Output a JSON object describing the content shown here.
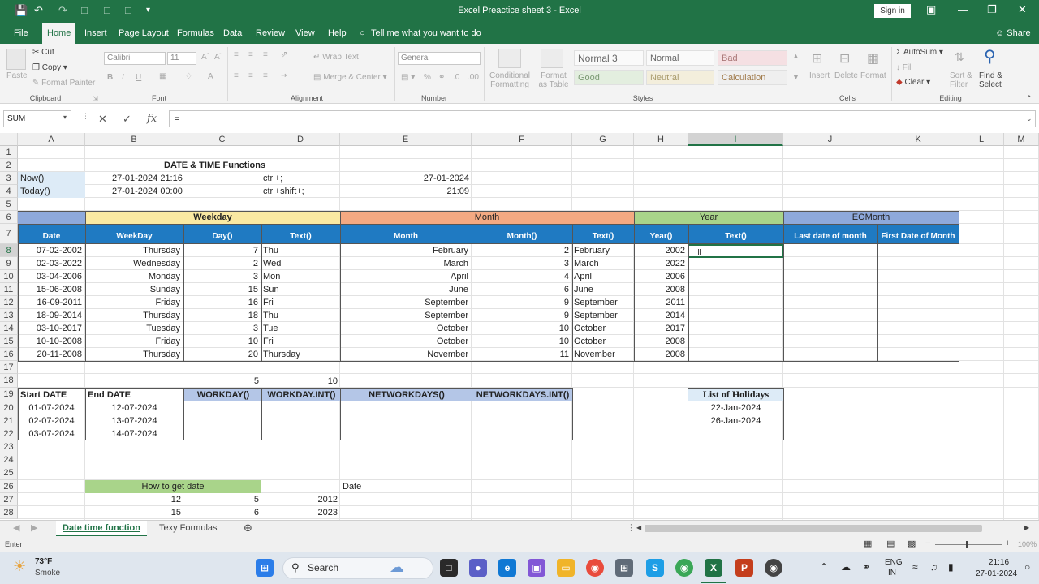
{
  "window": {
    "title": "Excel Preactice sheet 3  -  Excel",
    "sign_in": "Sign in",
    "share": "Share"
  },
  "menu": [
    "File",
    "Home",
    "Insert",
    "Page Layout",
    "Formulas",
    "Data",
    "Review",
    "View",
    "Help"
  ],
  "menu_active": "Home",
  "tell_me": "Tell me what you want to do",
  "ribbon": {
    "clipboard": {
      "paste": "Paste",
      "cut": "Cut",
      "copy": "Copy",
      "format_painter": "Format Painter",
      "label": "Clipboard"
    },
    "font": {
      "name": "Calibri",
      "size": "11",
      "label": "Font"
    },
    "alignment": {
      "wrap": "Wrap Text",
      "merge": "Merge & Center",
      "label": "Alignment"
    },
    "number": {
      "format": "General",
      "label": "Number"
    },
    "styles": {
      "conditional": "Conditional Formatting",
      "format_table": "Format as Table",
      "items": [
        "Normal 3",
        "Normal",
        "Bad",
        "Good",
        "Neutral",
        "Calculation"
      ],
      "label": "Styles"
    },
    "cells": {
      "insert": "Insert",
      "delete": "Delete",
      "format": "Format",
      "label": "Cells"
    },
    "editing": {
      "autosum": "AutoSum",
      "fill": "Fill",
      "clear": "Clear",
      "sort": "Sort & Filter",
      "find": "Find & Select",
      "label": "Editing"
    }
  },
  "formula_bar": {
    "name_box": "SUM",
    "content": "="
  },
  "columns": [
    "A",
    "B",
    "C",
    "D",
    "E",
    "F",
    "G",
    "H",
    "I",
    "J",
    "K",
    "L",
    "M"
  ],
  "selected_column": "I",
  "rows": [
    "1",
    "2",
    "3",
    "4",
    "5",
    "6",
    "7",
    "8",
    "9",
    "10",
    "11",
    "12",
    "13",
    "14",
    "15",
    "16",
    "17",
    "18",
    "19",
    "20",
    "21",
    "22",
    "23",
    "24",
    "25",
    "26",
    "27",
    "28"
  ],
  "selected_row": "8",
  "sheet": {
    "heading": "DATE & TIME Functions",
    "now_label": "Now()",
    "now_value": "27-01-2024 21:16",
    "now_shortcut": "ctrl+;",
    "now_result": "27-01-2024",
    "today_label": "Today()",
    "today_value": "27-01-2024 00:00",
    "today_shortcut": "ctrl+shift+;",
    "today_result": "21:09",
    "groups": {
      "weekday": "Weekday",
      "month": "Month",
      "year": "Year",
      "eomonth": "EOMonth"
    },
    "headers": [
      "Date",
      "WeekDay",
      "Day()",
      "Text()",
      "Month",
      "Month()",
      "Text()",
      "Year()",
      "Text()",
      "Last date of month",
      "First Date of Month"
    ],
    "table_rows": [
      [
        "07-02-2002",
        "Thursday",
        "7",
        "Thu",
        "February",
        "2",
        "February",
        "2002"
      ],
      [
        "02-03-2022",
        "Wednesday",
        "2",
        "Wed",
        "March",
        "3",
        "March",
        "2022"
      ],
      [
        "03-04-2006",
        "Monday",
        "3",
        "Mon",
        "April",
        "4",
        "April",
        "2006"
      ],
      [
        "15-06-2008",
        "Sunday",
        "15",
        "Sun",
        "June",
        "6",
        "June",
        "2008"
      ],
      [
        "16-09-2011",
        "Friday",
        "16",
        "Fri",
        "September",
        "9",
        "September",
        "2011"
      ],
      [
        "18-09-2014",
        "Thursday",
        "18",
        "Thu",
        "September",
        "9",
        "September",
        "2014"
      ],
      [
        "03-10-2017",
        "Tuesday",
        "3",
        "Tue",
        "October",
        "10",
        "October",
        "2017"
      ],
      [
        "10-10-2008",
        "Friday",
        "10",
        "Fri",
        "October",
        "10",
        "October",
        "2008"
      ],
      [
        "20-11-2008",
        "Thursday",
        "20",
        "Thursday",
        "November",
        "11",
        "November",
        "2008"
      ]
    ],
    "row18": [
      "5",
      "10"
    ],
    "workday_headers": [
      "Start DATE",
      "End  DATE",
      "WORKDAY()",
      "WORKDAY.INT()",
      "NETWORKDAYS()",
      "NETWORKDAYS.INT()"
    ],
    "workday_rows": [
      [
        "01-07-2024",
        "12-07-2024"
      ],
      [
        "02-07-2024",
        "13-07-2024"
      ],
      [
        "03-07-2024",
        "14-07-2024"
      ]
    ],
    "holidays_title": "List of Holidays",
    "holidays": [
      "22-Jan-2024",
      "26-Jan-2024"
    ],
    "how_to_get_date": "How to get date",
    "date_label": "Date",
    "row27": [
      "12",
      "5",
      "2012"
    ],
    "row28": [
      "15",
      "6",
      "2023"
    ]
  },
  "sheet_tabs": [
    "Date time function",
    "Texy Formulas"
  ],
  "active_sheet": "Date time function",
  "status": {
    "mode": "Enter",
    "zoom": "100%"
  },
  "taskbar": {
    "weather_temp": "73°F",
    "weather_desc": "Smoke",
    "search": "Search",
    "lang1": "ENG",
    "lang2": "IN",
    "time": "21:16",
    "date": "27-01-2024"
  },
  "colors": {
    "excel_green": "#217346",
    "header_blue": "#1f7ac2",
    "weekday_yellow": "#fae9a2",
    "month_orange": "#f3a982",
    "year_green": "#a9d48a",
    "eomonth_blue": "#8ea9db"
  }
}
